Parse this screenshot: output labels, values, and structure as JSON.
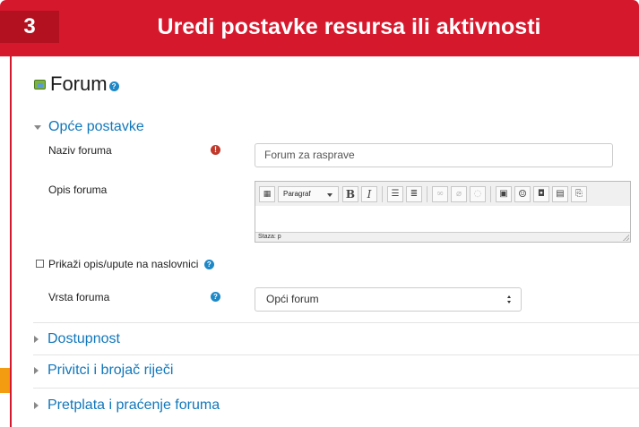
{
  "banner": {
    "step": "3",
    "title": "Uredi postavke resursa ili aktivnosti"
  },
  "page": {
    "title": "Forum"
  },
  "sections": {
    "general": "Opće postavke",
    "availability": "Dostupnost",
    "attachments": "Privitci i brojač riječi",
    "subscription": "Pretplata i praćenje foruma"
  },
  "form": {
    "name_label": "Naziv foruma",
    "name_value": "Forum za rasprave",
    "description_label": "Opis foruma",
    "show_description_label": "Prikaži opis/upute na naslovnici",
    "type_label": "Vrsta foruma",
    "type_value": "Opći forum"
  },
  "editor": {
    "paragraph_select": "Paragraf",
    "bold": "B",
    "italic": "I",
    "status_path": "Staza: p"
  },
  "icons": {
    "help": "?",
    "required": "!"
  },
  "colors": {
    "banner": "#d6182d",
    "link": "#1177bb",
    "accent": "#f39c12",
    "help": "#1e88c7",
    "required": "#c0392b"
  }
}
